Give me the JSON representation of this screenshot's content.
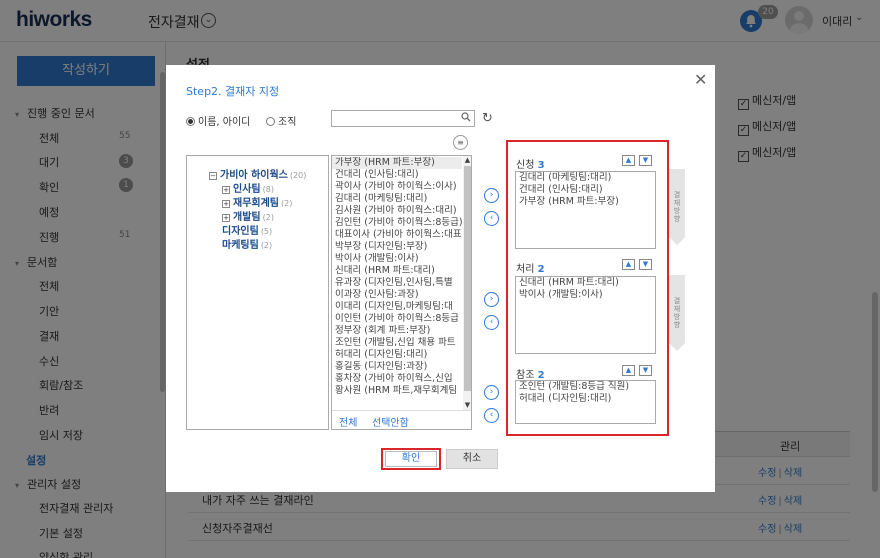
{
  "header": {
    "logo_main": "hiworks",
    "app_title": "전자결재",
    "notification_count": "20",
    "user_name": "이대리"
  },
  "sidebar": {
    "write_button": "작성하기",
    "groups": {
      "progress": "진행 중인 문서",
      "docbox": "문서함",
      "admin": "관리자 설정"
    },
    "progress_items": [
      {
        "label": "전체",
        "count": "55"
      },
      {
        "label": "대기",
        "count": "3"
      },
      {
        "label": "확인",
        "count": "1"
      },
      {
        "label": "예정",
        "count": ""
      },
      {
        "label": "진행",
        "count": "51"
      }
    ],
    "docbox_items": [
      "전체",
      "기안",
      "결재",
      "수신",
      "회람/참조",
      "반려",
      "임시 저장"
    ],
    "settings": "설정",
    "admin_items": [
      "전자결재 관리자",
      "기본 설정",
      "양식함 관리"
    ]
  },
  "background": {
    "page_title": "설정",
    "messenger_label": "메신저/앱",
    "table_header_manage": "관리",
    "rows": [
      {
        "name": "",
        "edit": "수정",
        "delete": "삭제"
      },
      {
        "name": "내가 자주 쓰는 결재라인",
        "edit": "수정",
        "delete": "삭제"
      },
      {
        "name": "신청자주결재선",
        "edit": "수정",
        "delete": "삭제"
      }
    ]
  },
  "modal": {
    "title": "Step2. 결재자 지정",
    "radio_name": "이름, 아이디",
    "radio_org": "조직",
    "search_placeholder": "",
    "tree": [
      {
        "label": "가비아 하이웍스",
        "count": "(20)",
        "level": 0,
        "toggle": "−"
      },
      {
        "label": "인사팀",
        "count": "(8)",
        "level": 1,
        "toggle": "+"
      },
      {
        "label": "재무회계팀",
        "count": "(2)",
        "level": 1,
        "toggle": "+"
      },
      {
        "label": "개발팀",
        "count": "(2)",
        "level": 1,
        "toggle": "+"
      },
      {
        "label": "디자인팀",
        "count": "(5)",
        "level": 1,
        "toggle": ""
      },
      {
        "label": "마케팅팀",
        "count": "(2)",
        "level": 1,
        "toggle": ""
      }
    ],
    "members": [
      "가부장 (HRM 파트:부장)",
      "건대리 (인사팀:대리)",
      "곽이사 (가비아 하이웍스:이사)",
      "김대리 (마케팅팀:대리)",
      "김사원 (가비아 하이웍스:대리)",
      "김인턴 (가비아 하이웍스:8등급)",
      "대표이사 (가비아 하이웍스:대표)",
      "박부장 (디자인팀:부장)",
      "박이사 (개발팀:이사)",
      "신대리 (HRM 파트:대리)",
      "유과장 (디자인팀,인사팀,특별",
      "이과장 (인사팀:과장)",
      "이대리 (디자인팀,마케팅팀:대",
      "이인턴 (가비아 하이웍스:8등급",
      "정부장 (회계 파트:부장)",
      "조인턴 (개발팀,신입 채용 파트",
      "허대리 (디자인팀:대리)",
      "홍길동 (디자인팀:과장)",
      "홍차장 (가비아 하이웍스,신입",
      "황사원 (HRM 파트,재무회계팀"
    ],
    "select_all": "전체",
    "deselect": "선택안함",
    "sections": [
      {
        "title": "신청",
        "count": "3",
        "items": [
          "김대리 (마케팅팀:대리)",
          "건대리 (인사팀:대리)",
          "가부장 (HRM 파트:부장)"
        ]
      },
      {
        "title": "처리",
        "count": "2",
        "items": [
          "신대리 (HRM 파트:대리)",
          "박이사 (개발팀:이사)"
        ]
      },
      {
        "title": "참조",
        "count": "2",
        "items": [
          "조인턴 (개발팀:8등급 직원)",
          "허대리 (디자인팀:대리)"
        ]
      }
    ],
    "direction_label": "결재방향",
    "ok": "확인",
    "cancel": "취소"
  }
}
